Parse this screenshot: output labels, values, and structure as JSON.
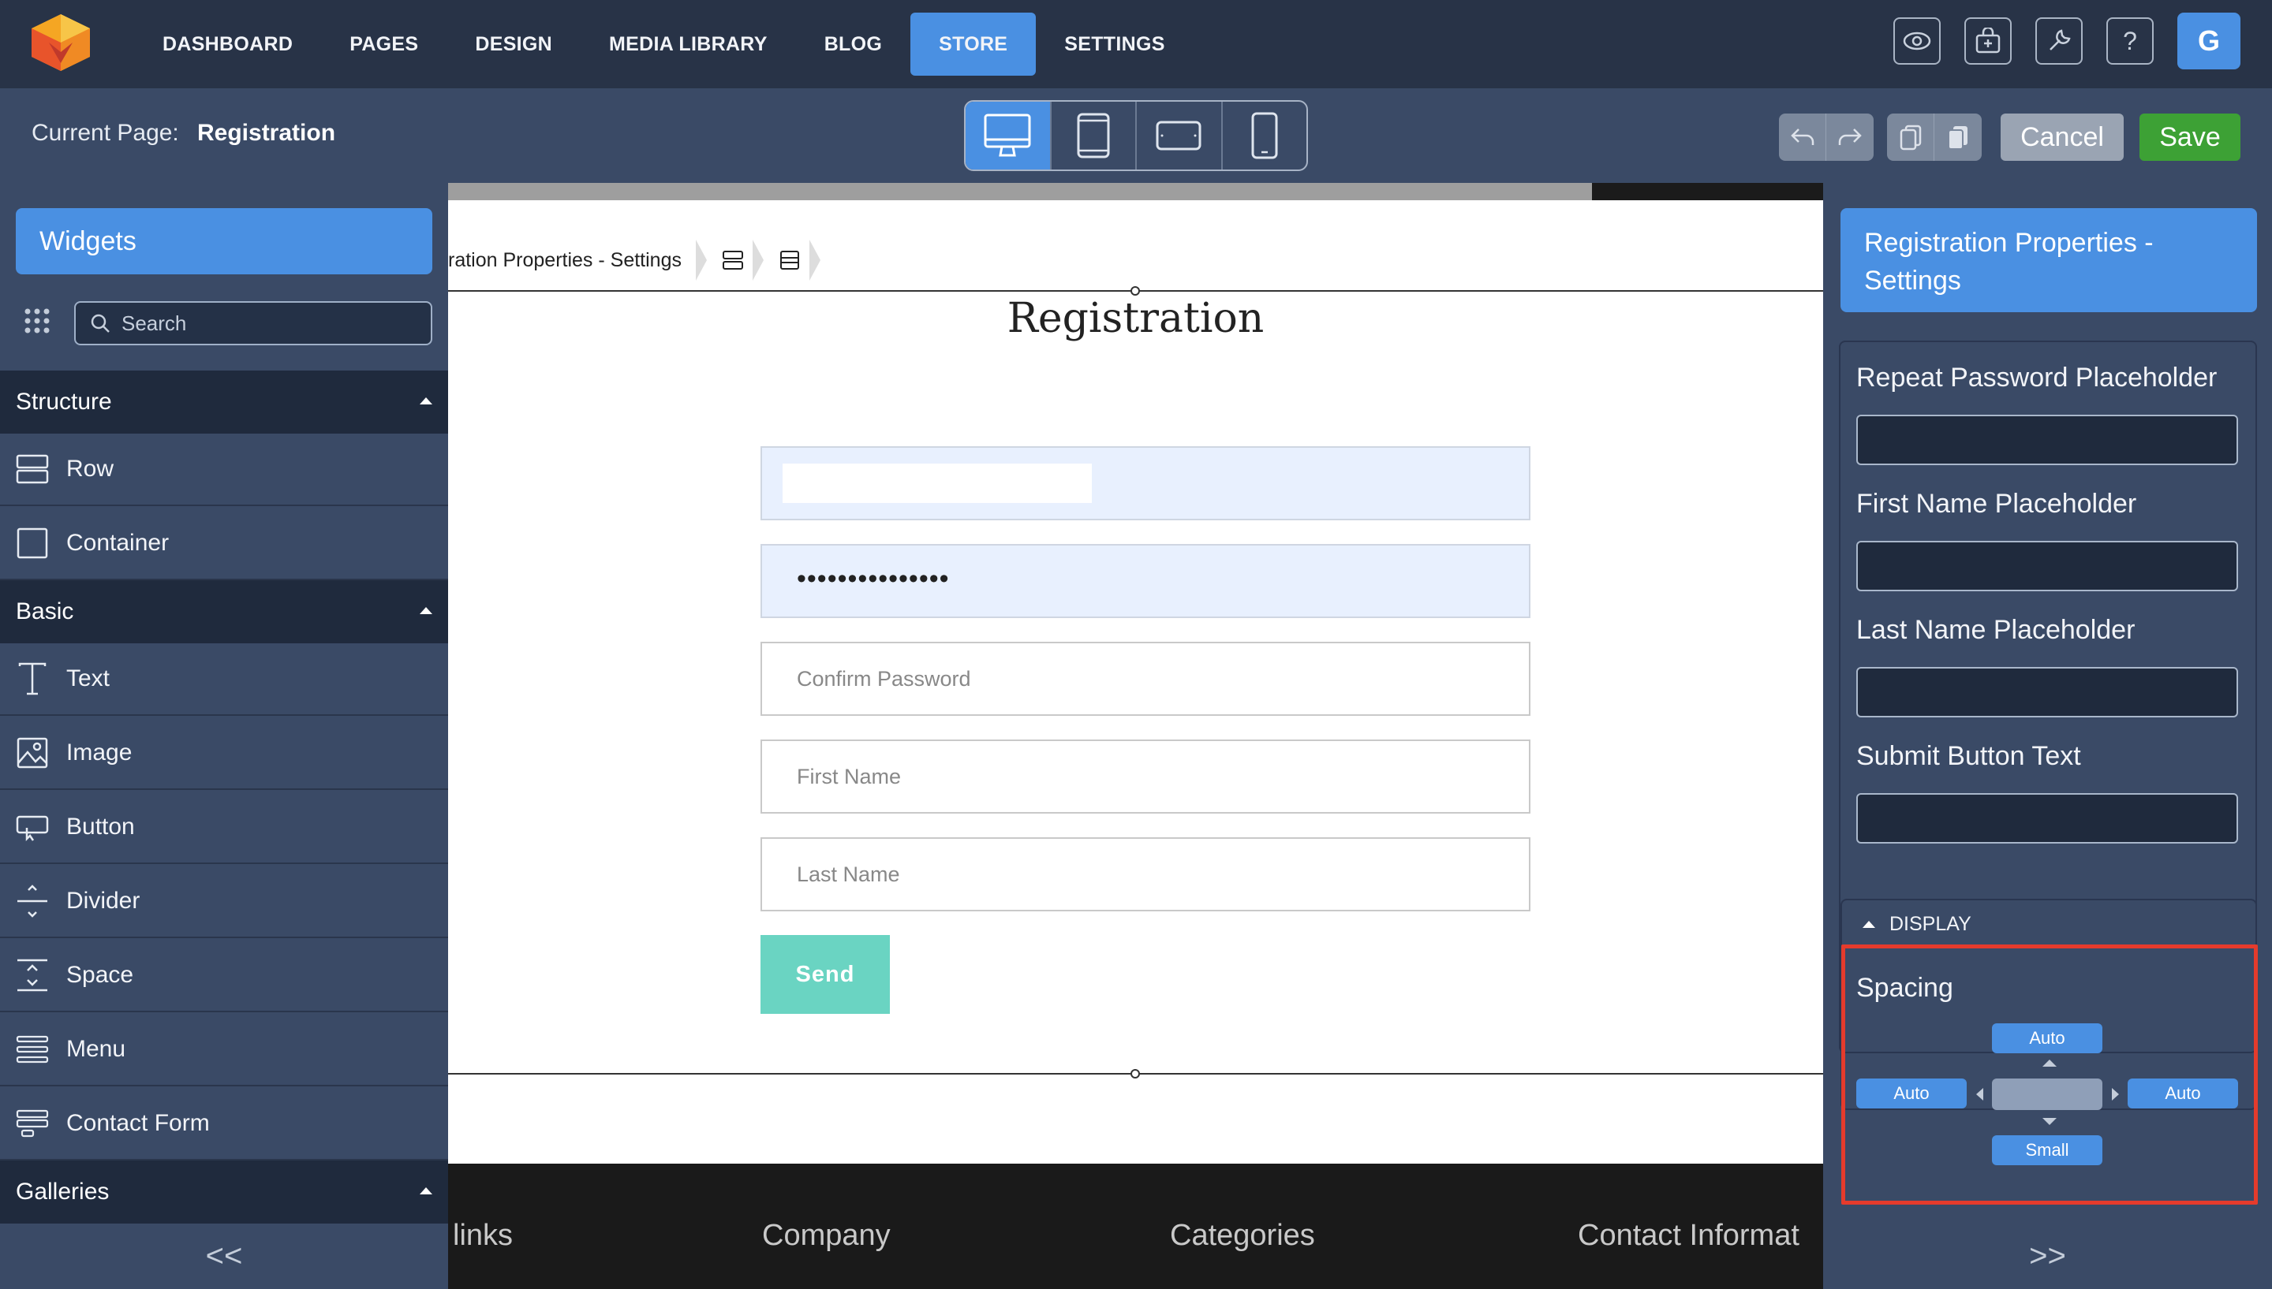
{
  "nav": {
    "items": [
      "DASHBOARD",
      "PAGES",
      "DESIGN",
      "MEDIA LIBRARY",
      "BLOG",
      "STORE",
      "SETTINGS"
    ],
    "active": "STORE",
    "tools": [
      "eye-icon",
      "store-icon",
      "wrench-icon",
      "help-icon"
    ],
    "help_glyph": "?",
    "avatar_letter": "G"
  },
  "subbar": {
    "current_page_label": "Current Page:",
    "current_page_name": "Registration",
    "devices": [
      "desktop",
      "tablet-portrait",
      "tablet-landscape",
      "phone"
    ],
    "cancel_label": "Cancel",
    "save_label": "Save"
  },
  "left_panel": {
    "widgets_title": "Widgets",
    "search_placeholder": "Search",
    "sections": {
      "structure": {
        "title": "Structure",
        "items": [
          "Row",
          "Container"
        ]
      },
      "basic": {
        "title": "Basic",
        "items": [
          "Text",
          "Image",
          "Button",
          "Divider",
          "Space",
          "Menu",
          "Contact Form"
        ]
      },
      "galleries": {
        "title": "Galleries"
      }
    },
    "collapse_label": "<<"
  },
  "canvas": {
    "breadcrumb": "ration Properties - Settings",
    "title": "Registration",
    "fields": {
      "password_dots": "•••••••••••••••",
      "confirm_password": "Confirm Password",
      "first_name": "First Name",
      "last_name": "Last Name"
    },
    "send_label": "Send",
    "footer": [
      "links",
      "Company",
      "Categories",
      "Contact Informat"
    ]
  },
  "right_panel": {
    "title": "Registration Properties - Settings",
    "labels": [
      "Repeat Password Placeholder",
      "First Name Placeholder",
      "Last Name Placeholder",
      "Submit Button Text"
    ],
    "display_label": "DISPLAY",
    "spacing_label": "Spacing",
    "spacing": {
      "top": "Auto",
      "left": "Auto",
      "right": "Auto",
      "bottom": "Small"
    },
    "collapse_label": ">>"
  },
  "colors": {
    "accent": "#4a90e2",
    "save": "#3da135",
    "highlight": "#e53b2c",
    "send": "#6ad4c2"
  }
}
